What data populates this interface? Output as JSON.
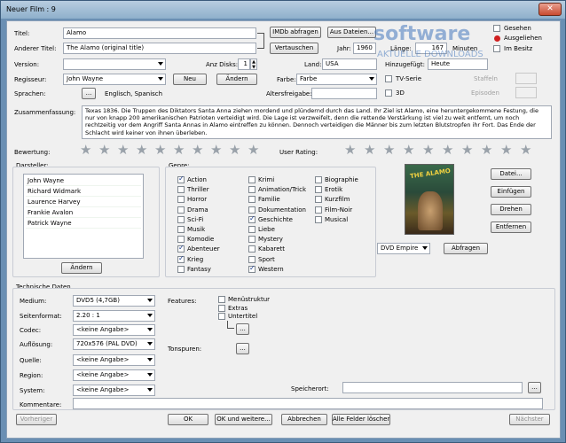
{
  "window": {
    "title": "Neuer Film : 9",
    "close": "✕"
  },
  "labels": {
    "titel": "Titel:",
    "anderer_titel": "Anderer Titel:",
    "version": "Version:",
    "anz_disks": "Anz Disks:",
    "land": "Land:",
    "regisseur": "Regisseur:",
    "farbe": "Farbe:",
    "sprachen": "Sprachen:",
    "altersfreigabe": "Altersfreigabe:",
    "zusammenfassung": "Zusammenfassung:",
    "jahr": "Jahr:",
    "laenge": "Länge:",
    "minuten": "Minuten",
    "hinzugefuegt": "Hinzugefügt:",
    "bewertung": "Bewertung:",
    "user_rating": "User Rating:",
    "darsteller": "Darsteller:",
    "genre": "Genre:",
    "technische_daten": "Technische Daten",
    "medium": "Medium:",
    "seitenformat": "Seitenformat:",
    "codec": "Codec:",
    "aufloesung": "Auflösung:",
    "quelle": "Quelle:",
    "region": "Region:",
    "system": "System:",
    "features": "Features:",
    "tonspuren": "Tonspuren:",
    "speicherort": "Speicherort:",
    "kommentare": "Kommentare:",
    "staffeln": "Staffeln",
    "episoden": "Episoden"
  },
  "fields": {
    "titel": "Alamo",
    "anderer_titel": "The Alamo (original title)",
    "version": "",
    "anz_disks": "1",
    "land": "USA",
    "jahr": "1960",
    "laenge": "167",
    "hinzugefuegt": "Heute",
    "regisseur": "John Wayne",
    "farbe": "Farbe",
    "sprachen": "Englisch, Spanisch",
    "altersfreigabe": "",
    "zusammenfassung": "Texas 1836. Die Truppen des Diktators Santa Anna ziehen mordend und plündernd durch das Land. Ihr Ziel ist Alamo, eine heruntergekommene Festung, die nur von knapp 200 amerikanischen Patrioten verteidigt wird. Die Lage ist verzweifelt, denn die rettende Verstärkung ist viel zu weit entfernt, um noch rechtzeitig vor dem Angriff Santa Annas in Alamo eintreffen zu können. Dennoch verteidigen die Männer bis zum letzten Blutstropfen ihr Fort. Das Ende der Schlacht wird keiner von ihnen überleben.",
    "medium": "DVD5 (4,7GB)",
    "seitenformat": "2.20 : 1",
    "codec": "<keine Angabe>",
    "aufloesung": "720x576 (PAL DVD)",
    "quelle": "<keine Angabe>",
    "region": "<keine Angabe>",
    "system": "<keine Angabe>",
    "speicherort": "",
    "kommentare": "",
    "cover_edition": "DVD Empire"
  },
  "buttons": {
    "imdb_abfragen": "IMDb abfragen",
    "aus_dateien": "Aus Dateien...",
    "vertauschen": "Vertauschen",
    "neu": "Neu",
    "aendern": "Ändern",
    "dots": "...",
    "darsteller_aendern": "Ändern",
    "datei": "Datei...",
    "einfuegen": "Einfügen",
    "drehen": "Drehen",
    "entfernen": "Entfernen",
    "abfragen": "Abfragen",
    "vorheriger": "Vorheriger",
    "ok": "OK",
    "ok_und_weitere": "OK und weitere...",
    "abbrechen": "Abbrechen",
    "alle_felder_loeschen": "Alle Felder löschen",
    "naechster": "Nächster"
  },
  "checks_right": {
    "gesehen": "Gesehen",
    "ausgeliehen": "Ausgeliehen",
    "im_besitz": "Im Besitz",
    "tv_serie": "TV-Serie",
    "dreid": "3D"
  },
  "actors": [
    "John Wayne",
    "Richard Widmark",
    "Laurence Harvey",
    "Frankie Avalon",
    "Patrick Wayne"
  ],
  "genres": [
    {
      "label": "Action",
      "checked": true
    },
    {
      "label": "Thriller",
      "checked": false
    },
    {
      "label": "Horror",
      "checked": false
    },
    {
      "label": "Drama",
      "checked": false
    },
    {
      "label": "Sci-Fi",
      "checked": false
    },
    {
      "label": "Musik",
      "checked": false
    },
    {
      "label": "Komodie",
      "checked": false
    },
    {
      "label": "Abenteuer",
      "checked": true
    },
    {
      "label": "Krieg",
      "checked": true
    },
    {
      "label": "Fantasy",
      "checked": false
    },
    {
      "label": "Krimi",
      "checked": false
    },
    {
      "label": "Animation/Trick",
      "checked": false
    },
    {
      "label": "Familie",
      "checked": false
    },
    {
      "label": "Dokumentation",
      "checked": false
    },
    {
      "label": "Geschichte",
      "checked": true
    },
    {
      "label": "Liebe",
      "checked": false
    },
    {
      "label": "Mystery",
      "checked": false
    },
    {
      "label": "Kabarett",
      "checked": false
    },
    {
      "label": "Sport",
      "checked": false
    },
    {
      "label": "Western",
      "checked": true
    },
    {
      "label": "Biographie",
      "checked": false
    },
    {
      "label": "Erotik",
      "checked": false
    },
    {
      "label": "Kurzfilm",
      "checked": false
    },
    {
      "label": "Film-Noir",
      "checked": false
    },
    {
      "label": "Musical",
      "checked": false
    }
  ],
  "features": [
    {
      "label": "Menüstruktur",
      "checked": false
    },
    {
      "label": "Extras",
      "checked": false
    },
    {
      "label": "Untertitel",
      "checked": false
    }
  ],
  "cover": {
    "title_text": "THE ALAMO"
  },
  "watermark": {
    "line1": "software",
    "line2": "AKTUELLE DOWNLOADS"
  }
}
